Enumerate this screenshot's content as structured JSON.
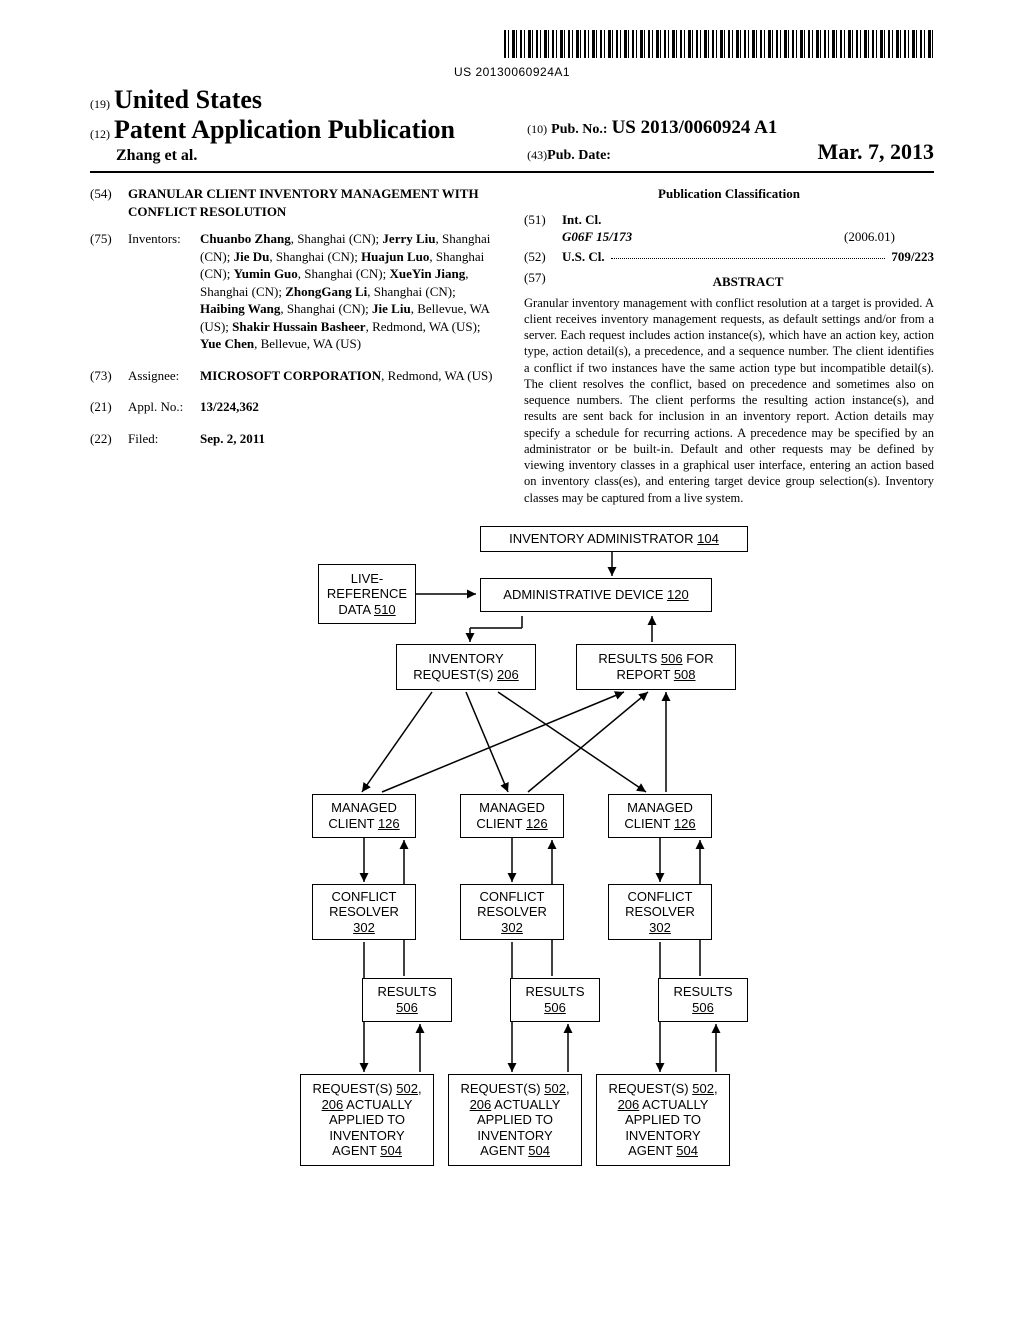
{
  "barcode_number": "US 20130060924A1",
  "header": {
    "num19": "(19)",
    "country": "United States",
    "num12": "(12)",
    "pub_type": "Patent Application Publication",
    "authors_short": "Zhang et al.",
    "num10": "(10)",
    "pub_no_label": "Pub. No.:",
    "pub_no": "US 2013/0060924 A1",
    "num43": "(43)",
    "pub_date_label": "Pub. Date:",
    "pub_date": "Mar. 7, 2013"
  },
  "fields": {
    "num54": "(54)",
    "title": "GRANULAR CLIENT INVENTORY MANAGEMENT WITH CONFLICT RESOLUTION",
    "num75": "(75)",
    "inventors_label": "Inventors:",
    "inventors_body": "Chuanbo Zhang, Shanghai (CN); Jerry Liu, Shanghai (CN); Jie Du, Shanghai (CN); Huajun Luo, Shanghai (CN); Yumin Guo, Shanghai (CN); XueYin Jiang, Shanghai (CN); ZhongGang Li, Shanghai (CN); Haibing Wang, Shanghai (CN); Jie Liu, Bellevue, WA (US); Shakir Hussain Basheer, Redmond, WA (US); Yue Chen, Bellevue, WA (US)",
    "num73": "(73)",
    "assignee_label": "Assignee:",
    "assignee_body": "MICROSOFT CORPORATION, Redmond, WA (US)",
    "num21": "(21)",
    "applno_label": "Appl. No.:",
    "applno": "13/224,362",
    "num22": "(22)",
    "filed_label": "Filed:",
    "filed": "Sep. 2, 2011"
  },
  "classification": {
    "heading": "Publication Classification",
    "num51": "(51)",
    "intcl_label": "Int. Cl.",
    "intcl_code": "G06F 15/173",
    "intcl_date": "(2006.01)",
    "num52": "(52)",
    "uscl_label": "U.S. Cl.",
    "uscl_val": "709/223",
    "num57": "(57)",
    "abstract_label": "ABSTRACT",
    "abstract_body": "Granular inventory management with conflict resolution at a target is provided. A client receives inventory management requests, as default settings and/or from a server. Each request includes action instance(s), which have an action key, action type, action detail(s), a precedence, and a sequence number. The client identifies a conflict if two instances have the same action type but incompatible detail(s). The client resolves the conflict, based on precedence and sometimes also on sequence numbers. The client performs the resulting action instance(s), and results are sent back for inclusion in an inventory report. Action details may specify a schedule for recurring actions. A precedence may be specified by an administrator or be built-in. Default and other requests may be defined by viewing inventory classes in a graphical user interface, entering an action based on inventory class(es), and entering target device group selection(s). Inventory classes may be captured from a live system."
  },
  "diagram": {
    "inv_admin": "INVENTORY ADMINISTRATOR ",
    "inv_admin_ref": "104",
    "live_ref": "LIVE-\nREFERENCE\nDATA ",
    "live_ref_ref": "510",
    "admin_device": "ADMINISTRATIVE DEVICE ",
    "admin_device_ref": "120",
    "inv_req": "INVENTORY\nREQUEST(S) ",
    "inv_req_ref": "206",
    "results_for": "RESULTS ",
    "results_for_ref": "506",
    "for_report": " FOR\nREPORT ",
    "report_ref": "508",
    "managed_client": "MANAGED\nCLIENT ",
    "managed_client_ref": "126",
    "conflict_resolver": "CONFLICT\nRESOLVER\n",
    "conflict_resolver_ref": "302",
    "results": "RESULTS\n",
    "results_ref": "506",
    "req_applied_a": "REQUEST(S) ",
    "req_applied_ref1": "502",
    "req_applied_ref2": "206",
    "req_applied_b": " ACTUALLY\nAPPLIED TO\nINVENTORY\nAGENT ",
    "req_applied_ref3": "504"
  }
}
